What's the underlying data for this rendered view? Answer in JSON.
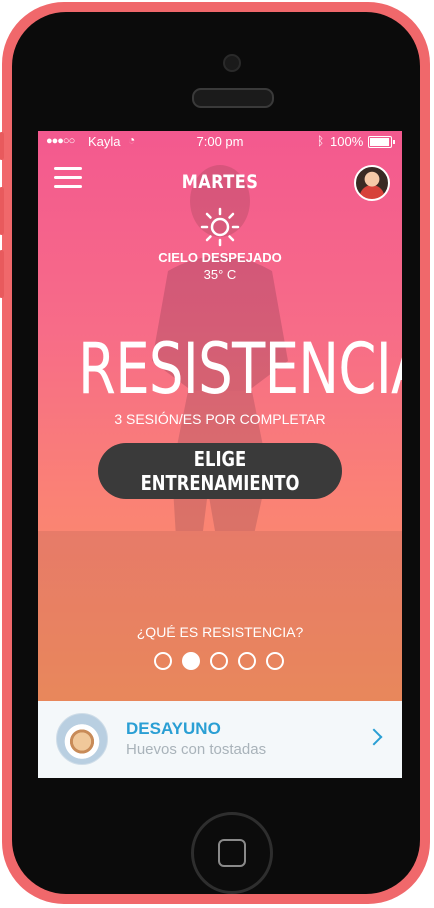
{
  "status": {
    "carrier": "Kayla",
    "time": "7:00 pm",
    "battery": "100%"
  },
  "header": {
    "day": "MARTES"
  },
  "weather": {
    "condition": "CIELO DESPEJADO",
    "temperature": "35° C"
  },
  "workout": {
    "title": "RESISTENCIA",
    "sessions": "3 SESIÓN/ES POR COMPLETAR",
    "cta_label": "ELIGE ENTRENAMIENTO",
    "question": "¿QUÉ ES RESISTENCIA?"
  },
  "pager": {
    "total": 5,
    "active": 2
  },
  "meal": {
    "title": "DESAYUNO",
    "subtitle": "Huevos con tostadas"
  },
  "colors": {
    "accent": "#2a9fd4",
    "button": "#3a3a3a",
    "phone": "#f0686b"
  }
}
